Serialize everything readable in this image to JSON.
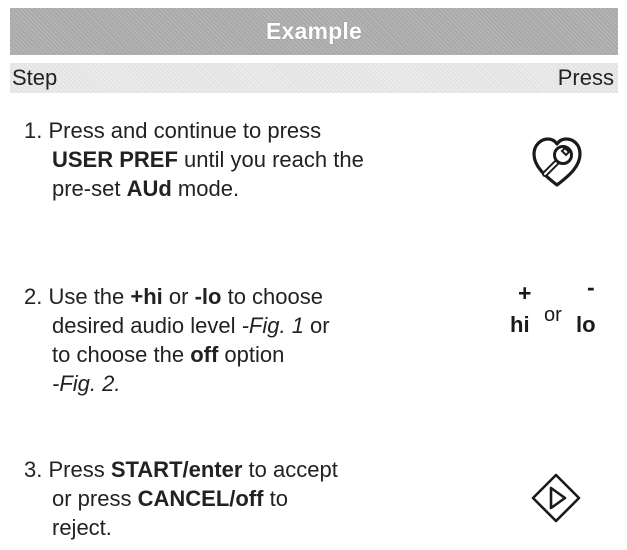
{
  "header": {
    "title": "Example"
  },
  "columns": {
    "step": "Step",
    "press": "Press"
  },
  "steps": [
    {
      "lines": [
        {
          "text": "1. Press and continue to press"
        },
        {
          "b1": "USER PREF",
          "t1": " until you reach the"
        },
        {
          "t1": "pre-set ",
          "b1": "AUd",
          "t2": " mode."
        }
      ],
      "icon": "user-pref-wrench-heart-icon"
    },
    {
      "lines": [
        {
          "t1": "2. Use the ",
          "b1": "+hi",
          "t2": " or ",
          "b2": "-lo",
          "t3": " to choose"
        },
        {
          "t1": "desired audio level ",
          "i1": "-Fig. 1",
          "t2": " or"
        },
        {
          "t1": "to choose the ",
          "b1": "off",
          "t2": " option"
        },
        {
          "i1": "-Fig. 2."
        }
      ],
      "keys": {
        "plus": "+",
        "minus": "-",
        "hi": "hi",
        "or": "or",
        "lo": "lo"
      }
    },
    {
      "lines": [
        {
          "t1": "3. Press ",
          "b1": "START/enter",
          "t2": " to accept"
        },
        {
          "t1": "or press ",
          "b1": "CANCEL/off",
          "t2": " to"
        },
        {
          "t1": "reject."
        }
      ],
      "icon": "start-diamond-icon"
    }
  ],
  "colors": {
    "header_bg": "#a9a9a9",
    "column_bar_bg": "#ebebeb",
    "text": "#222222"
  }
}
